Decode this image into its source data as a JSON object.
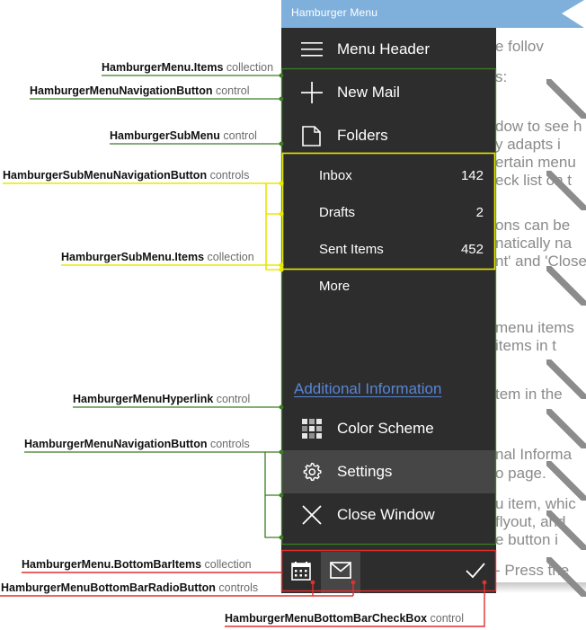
{
  "window": {
    "title": "Hamburger Menu",
    "titlebar_color": "#7FB0DB"
  },
  "background_text": [
    "e follov",
    "s:",
    "dow to see h",
    "y adapts i",
    "ertain menu",
    "eck list on t",
    "ons can be",
    "natically na",
    "nt' and 'Close",
    "menu items",
    "items in t",
    "tem in the",
    "nal Informa",
    "o page.",
    "u item, whic",
    "flyout, and",
    "e button i",
    "- Press the"
  ],
  "menu": {
    "header": {
      "label": "Menu Header",
      "icon": "hamburger-icon"
    },
    "items": [
      {
        "label": "New Mail",
        "icon": "plus-icon"
      },
      {
        "label": "Folders",
        "icon": "folder-icon"
      }
    ],
    "submenu": {
      "items": [
        {
          "label": "Inbox",
          "count": "142"
        },
        {
          "label": "Drafts",
          "count": "2"
        },
        {
          "label": "Sent Items",
          "count": "452"
        }
      ]
    },
    "more_label": "More",
    "hyperlink": {
      "label": "Additional Information"
    },
    "nav_items": [
      {
        "label": "Color Scheme",
        "icon": "color-grid-icon",
        "selected": false
      },
      {
        "label": "Settings",
        "icon": "gear-icon",
        "selected": true
      },
      {
        "label": "Close Window",
        "icon": "close-x-icon",
        "selected": false
      }
    ],
    "bottom_bar": {
      "items": [
        {
          "icon": "calendar-icon",
          "selected": false
        },
        {
          "icon": "mail-icon",
          "selected": true
        }
      ],
      "checkbox": {
        "icon": "checkmark-icon",
        "checked": true
      }
    }
  },
  "annotations": [
    {
      "bold": "HamburgerMenu.Items",
      "rest": " collection",
      "color": "#3a7d22"
    },
    {
      "bold": "HamburgerMenuNavigationButton",
      "rest": " control",
      "color": "#3a7d22"
    },
    {
      "bold": "HamburgerSubMenu",
      "rest": " control",
      "color": "#3a7d22"
    },
    {
      "bold": "HamburgerSubMenuNavigationButton",
      "rest": " controls",
      "color": "#e8e800"
    },
    {
      "bold": "HamburgerSubMenu.Items",
      "rest": " collection",
      "color": "#e8e800"
    },
    {
      "bold": "HamburgerMenuHyperlink",
      "rest": " control",
      "color": "#3a7d22"
    },
    {
      "bold": "HamburgerMenuNavigationButton",
      "rest": " controls",
      "color": "#3a7d22"
    },
    {
      "bold": "HamburgerMenu.BottomBarItems",
      "rest": " collection",
      "color": "#e03030"
    },
    {
      "bold": "HamburgerMenuBottomBarRadioButton",
      "rest": " controls",
      "color": "#e03030"
    },
    {
      "bold": "HamburgerMenuBottomBarCheckBox",
      "rest": " control",
      "color": "#e03030"
    }
  ],
  "colors": {
    "panel_bg": "#2d2d2d",
    "panel_selected": "#464646",
    "link": "#5686D8",
    "green": "#3a7d22",
    "yellow": "#e8e800",
    "red": "#e03030"
  }
}
